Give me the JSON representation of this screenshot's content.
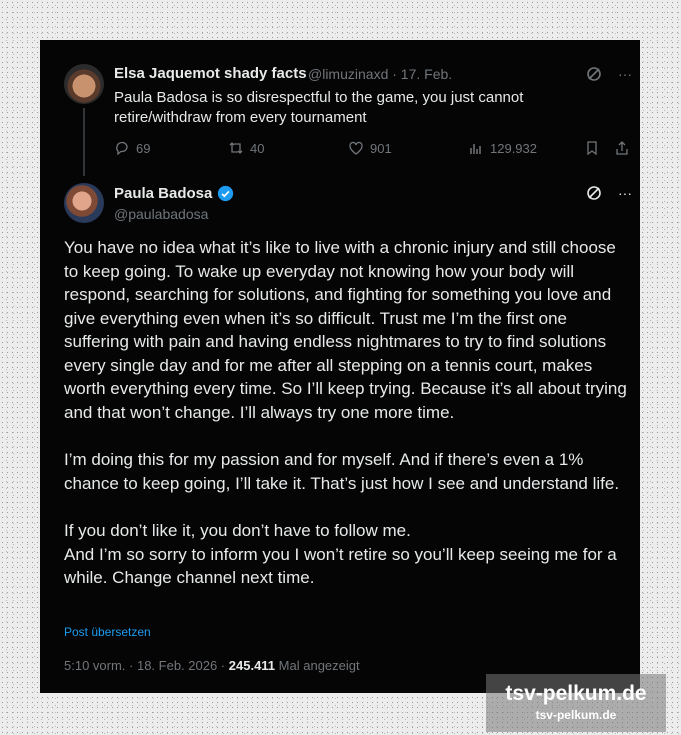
{
  "post1": {
    "author_name": "Elsa Jaquemot shady facts",
    "meta": "@limuzinaxd · 17. Feb.",
    "text": "Paula Badosa is so disrespectful to the game, you just cannot retire/withdraw from every tournament",
    "replies": "69",
    "reposts": "40",
    "likes": "901",
    "views": "129.932"
  },
  "post2": {
    "author_name": "Paula Badosa",
    "handle": "@paulabadosa",
    "paragraphs": [
      "You have no idea what it’s like to live with a chronic injury and still choose to keep going. To wake up everyday not knowing how your body will respond, searching for solutions, and fighting for something you love and give everything even when it’s so difficult. Trust me I’m the first one suffering with pain and having endless nightmares to try to find solutions every single day and for me after all stepping on a tennis court, makes worth everything every time. So I’ll keep trying. Because it’s all about trying and that won’t change. I’ll always try one more time.",
      "I’m doing this for my passion and for myself. And if there’s even a 1% chance to keep going, I’ll take it. That’s just how I see and understand life.",
      "If you don’t like it, you don’t have to follow me.",
      "And I’m so sorry to inform you I won’t retire so you’ll keep seeing me for a while. Change channel next time."
    ],
    "translate_link": "Post übersetzen",
    "timestamp": "5:10 vorm. · 18. Feb. 2026 ·",
    "view_count": "245.411",
    "view_label": "Mal angezeigt"
  },
  "watermark": {
    "line1": "tsv-pelkum.de",
    "line2": "tsv-pelkum.de"
  },
  "icons": [
    "grok-icon",
    "more-icon",
    "reply-icon",
    "repost-icon",
    "like-icon",
    "views-icon",
    "bookmark-icon",
    "share-icon",
    "verified-badge-icon"
  ],
  "colors": {
    "background": "#050505",
    "text": "#e7e9ea",
    "muted": "#71767b",
    "link": "#1d9bf0",
    "verified": "#1d9bf0"
  }
}
